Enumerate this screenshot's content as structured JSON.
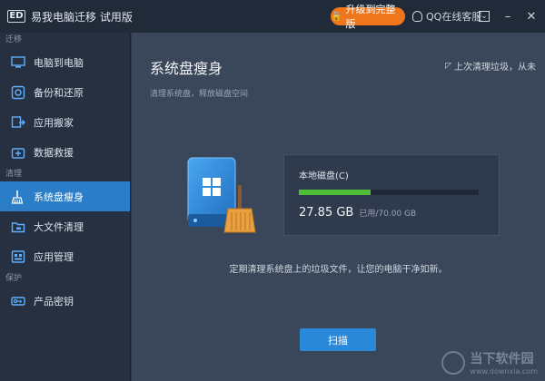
{
  "window": {
    "logo_text": "ED",
    "title": "易我电脑迁移 试用版",
    "upgrade_label": "升级到完整版",
    "qq_label": "QQ在线客服",
    "down_glyph": "⌄",
    "min_glyph": "–",
    "close_glyph": "✕"
  },
  "sidebar": {
    "groups": [
      {
        "label": "迁移",
        "items": [
          {
            "label": "电脑到电脑",
            "icon": "monitor-icon"
          },
          {
            "label": "备份和还原",
            "icon": "backup-icon"
          },
          {
            "label": "应用搬家",
            "icon": "app-move-icon"
          },
          {
            "label": "数据救援",
            "icon": "rescue-icon"
          }
        ]
      },
      {
        "label": "清理",
        "items": [
          {
            "label": "系统盘瘦身",
            "icon": "broom-icon",
            "active": true
          },
          {
            "label": "大文件清理",
            "icon": "folder-icon"
          },
          {
            "label": "应用管理",
            "icon": "app-manage-icon"
          }
        ]
      },
      {
        "label": "保护",
        "items": [
          {
            "label": "产品密钥",
            "icon": "key-icon"
          }
        ]
      }
    ]
  },
  "main": {
    "title": "系统盘瘦身",
    "last_clean": "上次清理垃圾，从未",
    "subtitle": "清理系统盘，释放磁盘空间",
    "disk": {
      "name": "本地磁盘(C)",
      "used": "27.85 GB",
      "total": "已用/70.00 GB",
      "used_fraction": 0.4
    },
    "tagline": "定期清理系统盘上的垃圾文件，让您的电脑干净如新。",
    "scan_label": "扫描"
  },
  "watermark": {
    "name": "当下软件园",
    "url": "www.downxia.com"
  },
  "colors": {
    "accent": "#2a88d8",
    "upgrade": "#f0761c",
    "progress": "#4fbf3a"
  }
}
